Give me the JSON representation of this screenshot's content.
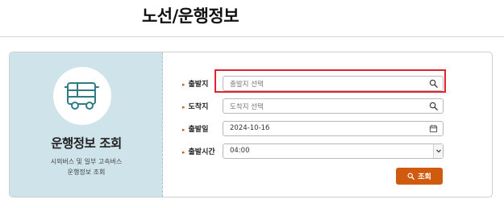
{
  "page": {
    "title": "노선/운행정보"
  },
  "sidebar": {
    "title": "운행정보 조회",
    "desc_line1": "시외버스 및 일부 고속버스",
    "desc_line2": "운행정보 조회",
    "icon": "bus-icon"
  },
  "form": {
    "departure": {
      "label": "출발지",
      "placeholder": "출발지 선택",
      "icon": "search-icon"
    },
    "arrival": {
      "label": "도착지",
      "placeholder": "도착지 선택",
      "icon": "search-icon"
    },
    "date": {
      "label": "출발일",
      "value": "2024-10-16",
      "icon": "calendar-icon"
    },
    "time": {
      "label": "출발시간",
      "value": "04:00",
      "icon": "chevron-down-icon"
    },
    "search_button": {
      "label": "조회",
      "icon": "search-icon"
    }
  },
  "colors": {
    "accent": "#cf5a10",
    "sidebar_bg": "#cfe3ea",
    "highlight": "#e0242f"
  }
}
